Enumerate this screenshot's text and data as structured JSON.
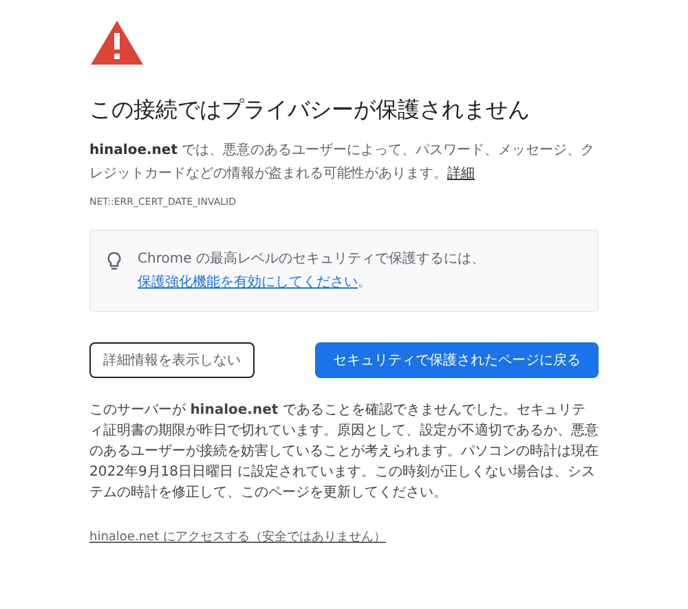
{
  "heading": "この接続ではプライバシーが保護されません",
  "intro": {
    "text": "**hinaloe.net** では、悪意のあるユーザーによって、パスワード、メッセージ、クレジットカードなどの情報が盗まれる可能性があります。",
    "link": "詳細"
  },
  "error_code": "NET::ERR_CERT_DATE_INVALID",
  "tip": {
    "text": "Chrome の最高レベルのセキュリティで保護するには、",
    "link": "保護強化機能を有効にしてください",
    "suffix": "。"
  },
  "buttons": [
    {
      "label": "詳細情報を表示しない",
      "kind": "secondary"
    },
    {
      "label": "セキュリティで保護されたページに戻る",
      "kind": "primary"
    }
  ],
  "details": "このサーバーが **hinaloe.net** であることを確認できませんでした。セキュリティ証明書の期限が昨日で切れています。原因として、設定が不適切であるか、悪意のあるユーザーが接続を妨害していることが考えられます。パソコンの時計は現在 2022年9月18日日曜日 に設定されています。この時刻が正しくない場合は、システムの時計を修正して、このページを更新してください。",
  "proceed_link": "hinaloe.net にアクセスする（安全ではありません）"
}
